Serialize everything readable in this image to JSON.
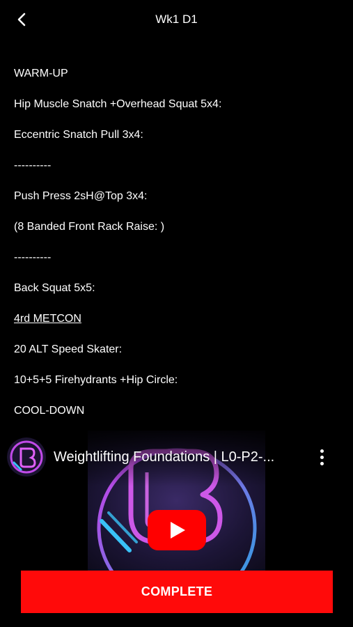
{
  "header": {
    "title": "Wk1 D1"
  },
  "workout": {
    "lines": [
      "WARM-UP",
      "Hip Muscle Snatch +Overhead Squat 5x4:",
      "Eccentric Snatch Pull 3x4:",
      "----------",
      "Push Press 2sH@Top 3x4:",
      "(8 Banded Front Rack Raise: )",
      "----------",
      "Back Squat 5x5:",
      "4rd METCON",
      "20 ALT Speed Skater:",
      "10+5+5 Firehydrants +Hip Circle:",
      "COOL-DOWN"
    ]
  },
  "video": {
    "title": "Weightlifting Foundations | L0-P2-..."
  },
  "complete_button": {
    "label": "COMPLETE"
  },
  "colors": {
    "background": "#000000",
    "accent": "#ff0a0a",
    "youtube_red": "#ff0000",
    "neon_pink": "#e040fb",
    "neon_blue": "#29b6f6"
  }
}
